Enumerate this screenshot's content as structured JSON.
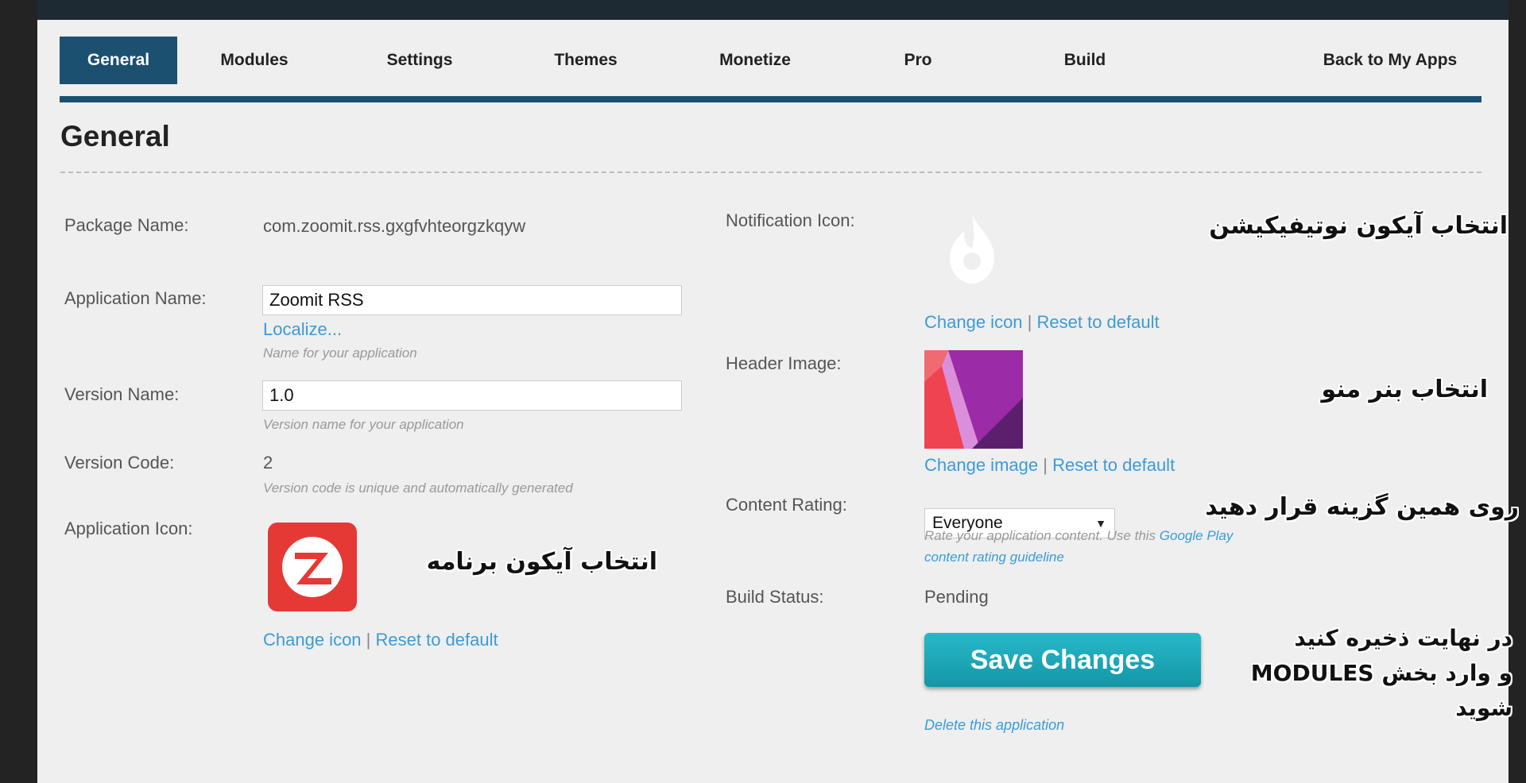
{
  "tabs": [
    {
      "label": "General",
      "active": true
    },
    {
      "label": "Modules"
    },
    {
      "label": "Settings"
    },
    {
      "label": "Themes"
    },
    {
      "label": "Monetize"
    },
    {
      "label": "Pro"
    },
    {
      "label": "Build"
    },
    {
      "label": "Back to My Apps"
    }
  ],
  "page": {
    "title": "General"
  },
  "left": {
    "package": {
      "label": "Package Name:",
      "value": "com.zoomit.rss.gxgfvhteorgzkqyw"
    },
    "app_name": {
      "label": "Application Name:",
      "value": "Zoomit RSS",
      "localize": "Localize...",
      "hint": "Name for your application"
    },
    "version_name": {
      "label": "Version Name:",
      "value": "1.0",
      "hint": "Version name for your application"
    },
    "version_code": {
      "label": "Version Code:",
      "value": "2",
      "hint": "Version code is unique and automatically generated"
    },
    "app_icon": {
      "label": "Application Icon:",
      "change": "Change icon",
      "separator": "|",
      "reset": "Reset to default"
    }
  },
  "right": {
    "notification_icon": {
      "label": "Notification Icon:",
      "change": "Change icon",
      "separator": "|",
      "reset": "Reset to default"
    },
    "header_image": {
      "label": "Header Image:",
      "change": "Change image",
      "separator": "|",
      "reset": "Reset to default"
    },
    "content_rating": {
      "label": "Content Rating:",
      "selected": "Everyone",
      "hint_text": "Rate your application content. Use this",
      "hint_link_1": "Google Play",
      "hint_link_2": "content rating guideline"
    },
    "build_status": {
      "label": "Build Status:",
      "value": "Pending"
    },
    "save_label": "Save Changes",
    "delete_label": "Delete this application"
  },
  "annotations": {
    "notification": "انتخاب آیکون نوتیفیکیشن",
    "header": "انتخاب بنر منو",
    "rating": "روی همین گزینه قرار دهید",
    "app_icon": "انتخاب آیکون برنامه",
    "save_line1": "در نهایت ذخیره کنید",
    "save_line2": "و وارد بخش MODULES",
    "save_line3": "شوید"
  },
  "colors": {
    "accent": "#1b5071",
    "link": "#3a9bd9",
    "button": "#1ea8b9",
    "app_icon_bg": "#e53935"
  }
}
